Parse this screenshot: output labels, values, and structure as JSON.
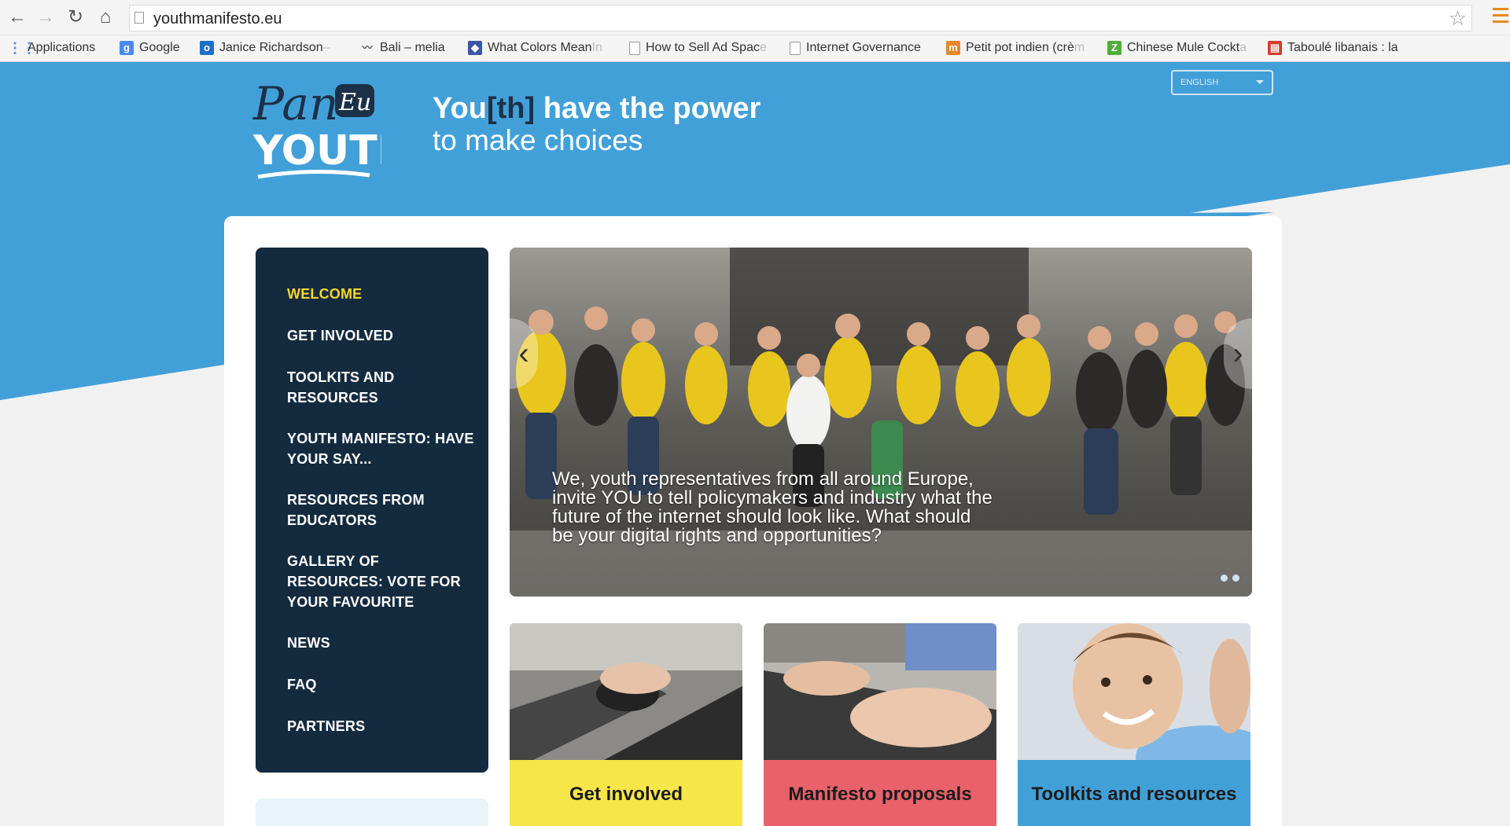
{
  "browser": {
    "url": "youthmanifesto.eu",
    "bookmarks": [
      {
        "label": "Applications",
        "icon": "apps-grid-icon",
        "color": "#4a8af4"
      },
      {
        "label": "Google",
        "icon": "google-icon",
        "color": "#4a8af4"
      },
      {
        "label": "Janice Richardson",
        "trail": " –",
        "icon": "outlook-icon",
        "color": "#1f6fc5"
      },
      {
        "label": "Bali – melia",
        "icon": "bird-icon",
        "color": "#666666"
      },
      {
        "label": "What Colors Mean",
        "trail": " In",
        "icon": "color-icon",
        "color": "#3b55a8"
      },
      {
        "label": "How to Sell Ad Spac",
        "trail": "e",
        "icon": "page-icon",
        "color": "#ffffff"
      },
      {
        "label": "Internet Governance",
        "icon": "page-icon",
        "color": "#ffffff"
      },
      {
        "label": "Petit pot indien (crè",
        "trail": "m",
        "icon": "marmiton-icon",
        "color": "#e8872c"
      },
      {
        "label": "Chinese Mule Cockt",
        "trail": "a",
        "icon": "z-icon",
        "color": "#4fae3a"
      },
      {
        "label": "Taboulé libanais : la",
        "icon": "recipe-icon",
        "color": "#d83a2f"
      }
    ]
  },
  "header": {
    "logo_text": "Pan EU YOUTH",
    "tagline_you": "You",
    "tagline_th": "[th]",
    "tagline_rest": " have the power",
    "tagline_line2": "to make choices",
    "language": "ENGLISH"
  },
  "nav": {
    "items": [
      {
        "label": "WELCOME",
        "active": true
      },
      {
        "label": "GET INVOLVED"
      },
      {
        "label": "TOOLKITS AND RESOURCES"
      },
      {
        "label": "YOUTH MANIFESTO: HAVE YOUR SAY..."
      },
      {
        "label": "RESOURCES FROM EDUCATORS"
      },
      {
        "label": "GALLERY OF RESOURCES: VOTE FOR YOUR FAVOURITE"
      },
      {
        "label": "NEWS"
      },
      {
        "label": "FAQ"
      },
      {
        "label": "PARTNERS"
      }
    ]
  },
  "slider": {
    "caption": "We, youth representatives from all around Europe, invite YOU to tell policymakers and industry what the future of the internet should look like. What should be your digital rights and opportunities?",
    "slide_count": 2
  },
  "cards": [
    {
      "label": "Get involved",
      "color": "#f7e64a"
    },
    {
      "label": "Manifesto proposals",
      "color": "#e9616a"
    },
    {
      "label": "Toolkits and resources",
      "color": "#42a0d9"
    }
  ],
  "colors": {
    "brand_blue": "#42a0d9",
    "nav_dark": "#142b3f",
    "active_yellow": "#f5d62d"
  }
}
